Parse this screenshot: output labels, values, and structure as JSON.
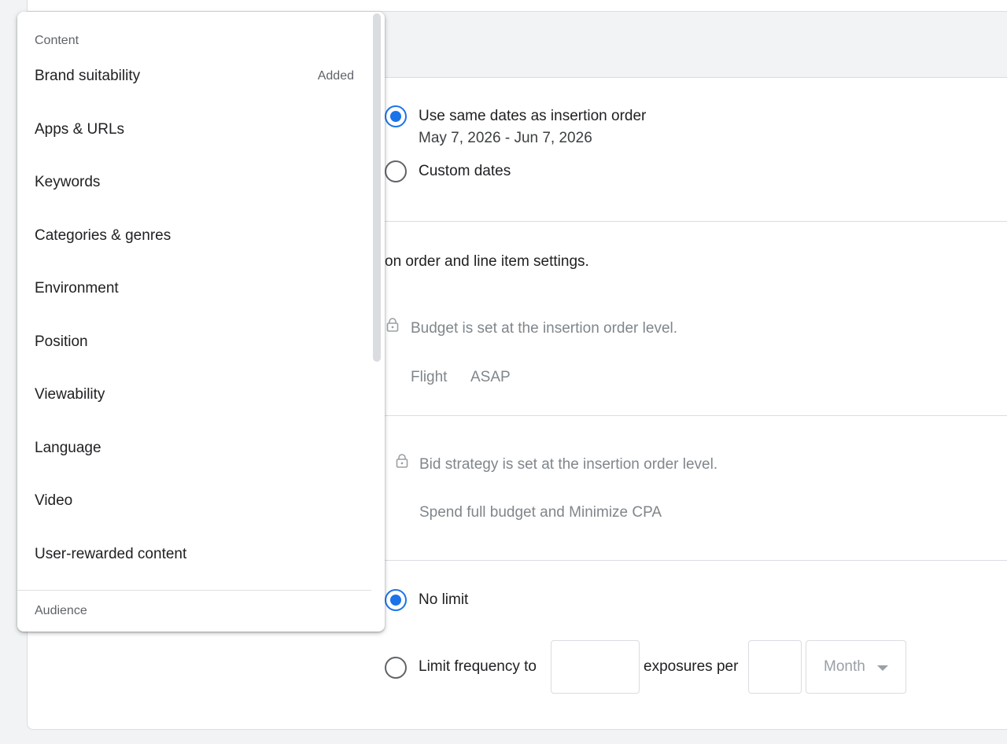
{
  "flight": {
    "option_same": "Use same dates as insertion order",
    "date_range": "May 7, 2026 - Jun 7, 2026",
    "option_custom": "Custom dates"
  },
  "budget": {
    "intro": "on order and line item settings.",
    "lock_text": "Budget is set at the insertion order level.",
    "flight_label": "Flight",
    "flight_value": "ASAP"
  },
  "bid": {
    "lock_text": "Bid strategy is set at the insertion order level.",
    "strategy": "Spend full budget and Minimize CPA"
  },
  "frequency": {
    "no_limit": "No limit",
    "limit_label": "Limit frequency to",
    "exposures_per": "exposures per",
    "period_value": "Month"
  },
  "menu": {
    "content_header": "Content",
    "items": [
      {
        "label": "Brand suitability",
        "badge": "Added"
      },
      {
        "label": "Apps & URLs",
        "badge": ""
      },
      {
        "label": "Keywords",
        "badge": ""
      },
      {
        "label": "Categories & genres",
        "badge": ""
      },
      {
        "label": "Environment",
        "badge": ""
      },
      {
        "label": "Position",
        "badge": ""
      },
      {
        "label": "Viewability",
        "badge": ""
      },
      {
        "label": "Language",
        "badge": ""
      },
      {
        "label": "Video",
        "badge": ""
      },
      {
        "label": "User-rewarded content",
        "badge": ""
      }
    ],
    "audience_header": "Audience"
  },
  "colors": {
    "accent": "#1a73e8",
    "muted_text": "#80868b",
    "border": "#dadce0",
    "background": "#f1f3f4"
  },
  "icons": {
    "lock": "lock-icon",
    "dropdown_caret": "arrow-drop-down-icon"
  }
}
